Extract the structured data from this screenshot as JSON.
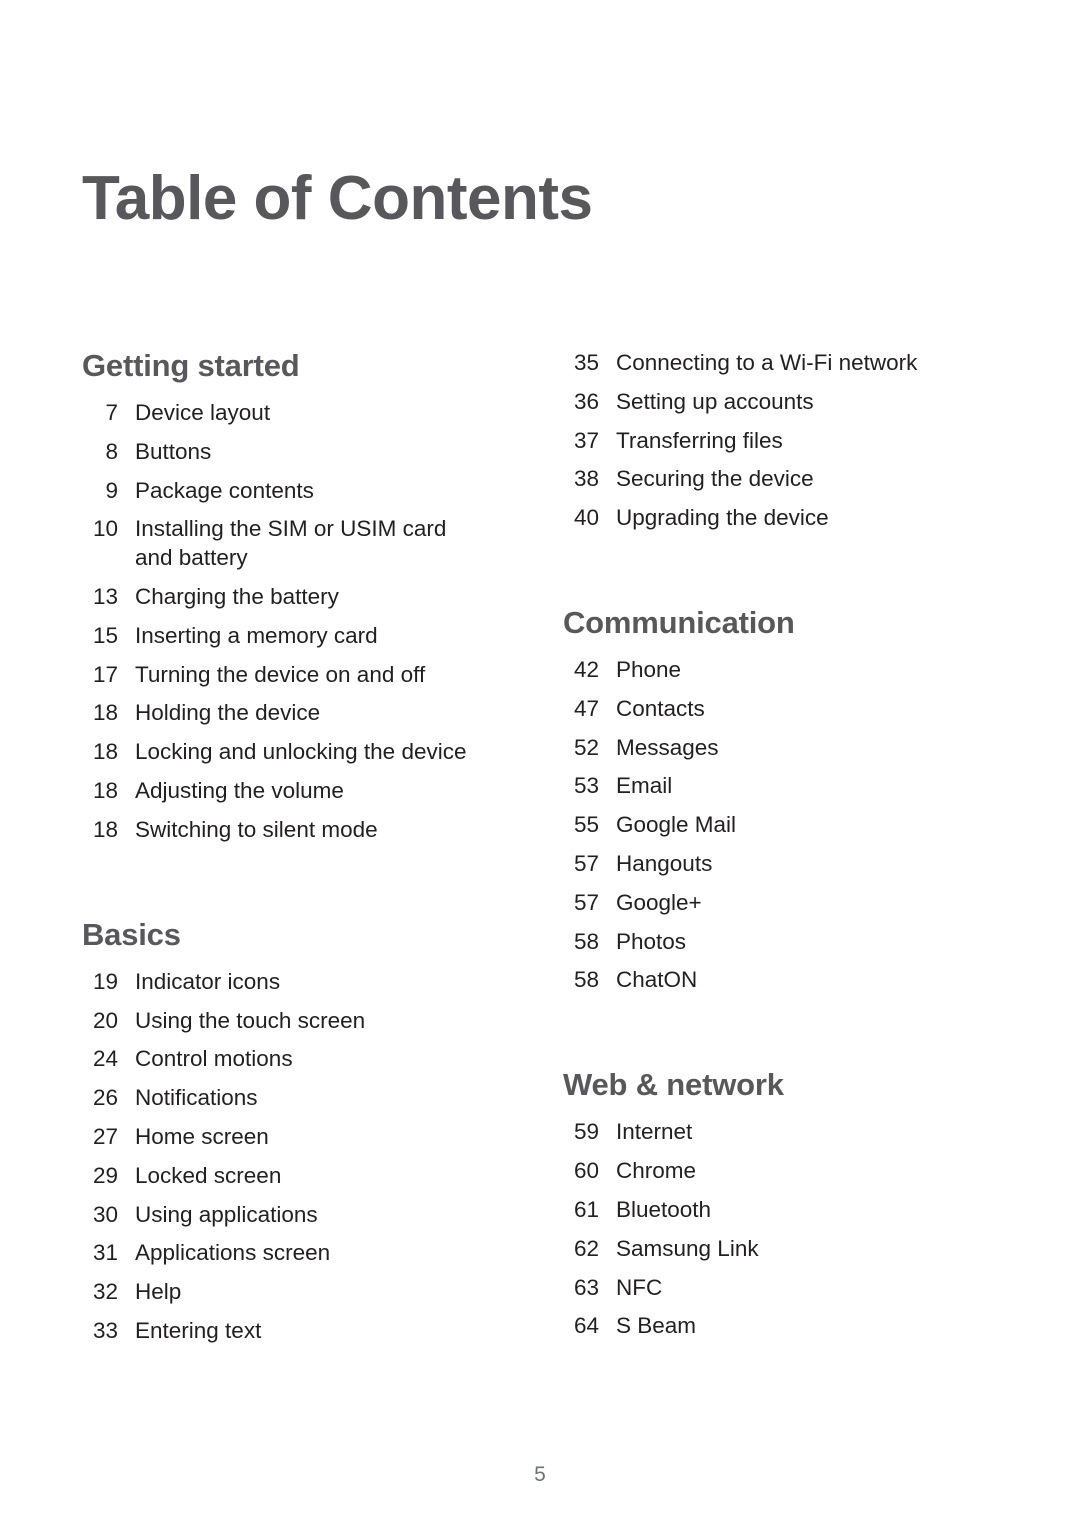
{
  "document": {
    "title": "Table of Contents",
    "folio": "5",
    "colors": {
      "heading": "#58585c",
      "body": "#231f20",
      "folio": "#6b7377",
      "background": "#ffffff"
    }
  },
  "columns": [
    {
      "name": "left-column",
      "blocks": [
        {
          "type": "section",
          "heading": "Getting started",
          "entries": [
            {
              "page": "7",
              "title": "Device layout"
            },
            {
              "page": "8",
              "title": "Buttons"
            },
            {
              "page": "9",
              "title": "Package contents"
            },
            {
              "page": "10",
              "title": "Installing the SIM or USIM card and battery"
            },
            {
              "page": "13",
              "title": "Charging the battery"
            },
            {
              "page": "15",
              "title": "Inserting a memory card"
            },
            {
              "page": "17",
              "title": "Turning the device on and off"
            },
            {
              "page": "18",
              "title": "Holding the device"
            },
            {
              "page": "18",
              "title": "Locking and unlocking the device"
            },
            {
              "page": "18",
              "title": "Adjusting the volume"
            },
            {
              "page": "18",
              "title": "Switching to silent mode"
            }
          ]
        },
        {
          "type": "section",
          "heading": "Basics",
          "entries": [
            {
              "page": "19",
              "title": "Indicator icons"
            },
            {
              "page": "20",
              "title": "Using the touch screen"
            },
            {
              "page": "24",
              "title": "Control motions"
            },
            {
              "page": "26",
              "title": "Notifications"
            },
            {
              "page": "27",
              "title": "Home screen"
            },
            {
              "page": "29",
              "title": "Locked screen"
            },
            {
              "page": "30",
              "title": "Using applications"
            },
            {
              "page": "31",
              "title": "Applications screen"
            },
            {
              "page": "32",
              "title": "Help"
            },
            {
              "page": "33",
              "title": "Entering text"
            }
          ]
        }
      ]
    },
    {
      "name": "right-column",
      "blocks": [
        {
          "type": "continuation",
          "heading": "",
          "entries": [
            {
              "page": "35",
              "title": "Connecting to a Wi-Fi network"
            },
            {
              "page": "36",
              "title": "Setting up accounts"
            },
            {
              "page": "37",
              "title": "Transferring files"
            },
            {
              "page": "38",
              "title": "Securing the device"
            },
            {
              "page": "40",
              "title": "Upgrading the device"
            }
          ]
        },
        {
          "type": "section",
          "heading": "Communication",
          "entries": [
            {
              "page": "42",
              "title": "Phone"
            },
            {
              "page": "47",
              "title": "Contacts"
            },
            {
              "page": "52",
              "title": "Messages"
            },
            {
              "page": "53",
              "title": "Email"
            },
            {
              "page": "55",
              "title": "Google Mail"
            },
            {
              "page": "57",
              "title": "Hangouts"
            },
            {
              "page": "57",
              "title": "Google+"
            },
            {
              "page": "58",
              "title": "Photos"
            },
            {
              "page": "58",
              "title": "ChatON"
            }
          ]
        },
        {
          "type": "section",
          "heading": "Web & network",
          "entries": [
            {
              "page": "59",
              "title": "Internet"
            },
            {
              "page": "60",
              "title": "Chrome"
            },
            {
              "page": "61",
              "title": "Bluetooth"
            },
            {
              "page": "62",
              "title": "Samsung Link"
            },
            {
              "page": "63",
              "title": "NFC"
            },
            {
              "page": "64",
              "title": "S Beam"
            }
          ]
        }
      ]
    }
  ]
}
